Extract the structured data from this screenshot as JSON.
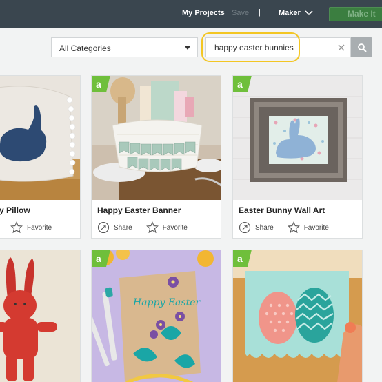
{
  "topbar": {
    "my_projects": "My Projects",
    "save": "Save",
    "separator": "|",
    "maker": "Maker",
    "make_it": "Make It"
  },
  "search": {
    "category": "All Categories",
    "query": "happy easter bunnies"
  },
  "cards": [
    {
      "title": "y Pillow",
      "favorite": "Favorite"
    },
    {
      "title": "Happy Easter Banner",
      "share": "Share",
      "favorite": "Favorite"
    },
    {
      "title": "Easter Bunny Wall Art",
      "share": "Share",
      "favorite": "Favorite"
    }
  ],
  "card_images": {
    "happy_text": "Happy Easter"
  },
  "colors": {
    "topbar": "#3a464f",
    "accent_green": "#3b7e40",
    "badge_green": "#6fbf3b",
    "highlight": "#f3c623"
  }
}
